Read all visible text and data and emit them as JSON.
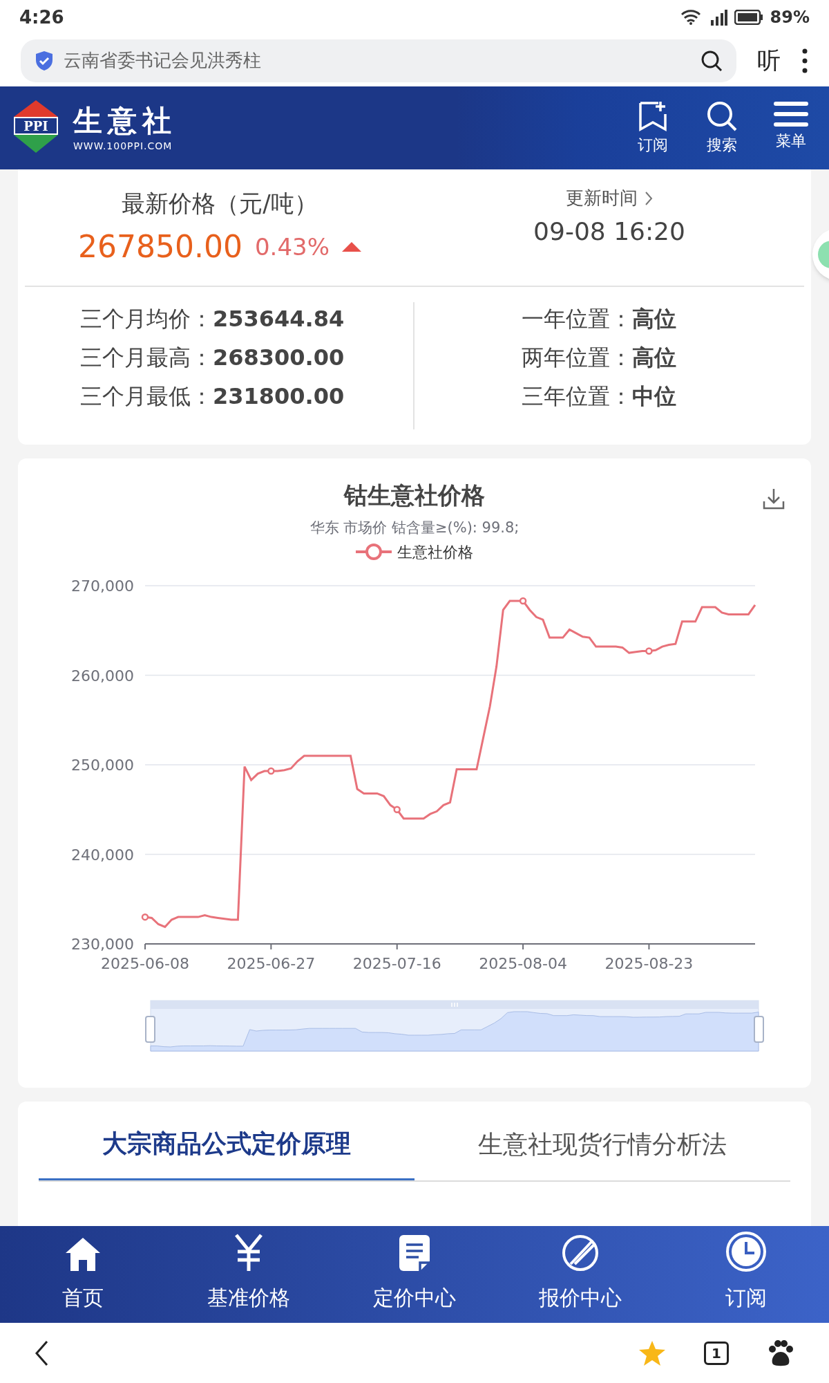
{
  "status_bar": {
    "time": "4:26",
    "battery": "89%"
  },
  "address_bar": {
    "query": "云南省委书记会见洪秀柱",
    "listen": "听"
  },
  "site_header": {
    "name": "生意社",
    "url": "WWW.100PPI.COM",
    "logo": "PPI",
    "actions": [
      "订阅",
      "搜索",
      "菜单"
    ]
  },
  "price": {
    "label": "最新价格（元/吨）",
    "value": "267850.00",
    "change": "0.43%",
    "rising": true,
    "update_label": "更新时间",
    "update_time": "09-08 16:20"
  },
  "stats_left": [
    {
      "label": "三个月均价：",
      "value": "253644.84"
    },
    {
      "label": "三个月最高：",
      "value": "268300.00"
    },
    {
      "label": "三个月最低：",
      "value": "231800.00"
    }
  ],
  "stats_right": [
    {
      "label": "一年位置：",
      "value": "高位"
    },
    {
      "label": "两年位置：",
      "value": "高位"
    },
    {
      "label": "三年位置：",
      "value": "中位"
    }
  ],
  "chart": {
    "chart_data": {
      "type": "line",
      "title": "钴生意社价格",
      "subtitle": "华东 市场价 钴含量≥(%): 99.8;",
      "grid": true,
      "categories": [
        "2025-06-08",
        null,
        null,
        null,
        null,
        null,
        null,
        null,
        null,
        null,
        null,
        null,
        null,
        null,
        null,
        null,
        null,
        null,
        null,
        "2025-06-27",
        null,
        null,
        null,
        null,
        null,
        null,
        null,
        null,
        null,
        null,
        null,
        null,
        null,
        null,
        null,
        null,
        null,
        null,
        "2025-07-16",
        null,
        null,
        null,
        null,
        null,
        null,
        null,
        null,
        null,
        null,
        null,
        null,
        null,
        null,
        null,
        null,
        null,
        null,
        "2025-08-04",
        null,
        null,
        null,
        null,
        null,
        null,
        null,
        null,
        null,
        null,
        null,
        null,
        null,
        null,
        null,
        null,
        null,
        null,
        "2025-08-23",
        null,
        null,
        null,
        null,
        null,
        null,
        null,
        null,
        null,
        null,
        null,
        null,
        null,
        null,
        null,
        null
      ],
      "series": [
        {
          "name": "生意社价格",
          "color": "#e8727a",
          "values": [
            233000,
            232900,
            232200,
            231900,
            232700,
            233000,
            233000,
            233000,
            233000,
            233200,
            233000,
            232900,
            232800,
            232700,
            232700,
            249800,
            248300,
            249000,
            249300,
            249300,
            249300,
            249400,
            249600,
            250400,
            251000,
            251000,
            251000,
            251000,
            251000,
            251000,
            251000,
            251000,
            247300,
            246800,
            246800,
            246800,
            246500,
            245500,
            245000,
            244000,
            244000,
            244000,
            244000,
            244500,
            244800,
            245500,
            245800,
            249500,
            249500,
            249500,
            249500,
            253000,
            256500,
            261000,
            267300,
            268300,
            268300,
            268300,
            267300,
            266500,
            266200,
            264200,
            264200,
            264200,
            265100,
            264700,
            264300,
            264200,
            263200,
            263200,
            263200,
            263200,
            263100,
            262500,
            262600,
            262700,
            262700,
            262800,
            263200,
            263400,
            263500,
            266000,
            266000,
            266000,
            267600,
            267600,
            267600,
            267000,
            266800,
            266800,
            266800,
            266800,
            267850
          ]
        }
      ],
      "ylim": [
        230000,
        270000
      ],
      "yticks": [
        {
          "value": 230000,
          "label": "230,000"
        },
        {
          "value": 240000,
          "label": "240,000"
        },
        {
          "value": 250000,
          "label": "250,000"
        },
        {
          "value": 260000,
          "label": "260,000"
        },
        {
          "value": 270000,
          "label": "270,000"
        }
      ]
    }
  },
  "tabs": [
    {
      "label": "大宗商品公式定价原理",
      "selected": true
    },
    {
      "label": "生意社现货行情分析法",
      "selected": false
    }
  ],
  "bottom_nav": [
    {
      "label": "首页"
    },
    {
      "label": "基准价格"
    },
    {
      "label": "定价中心"
    },
    {
      "label": "报价中心"
    },
    {
      "label": "订阅"
    }
  ],
  "browser_bar": {
    "tab_count": "1"
  }
}
